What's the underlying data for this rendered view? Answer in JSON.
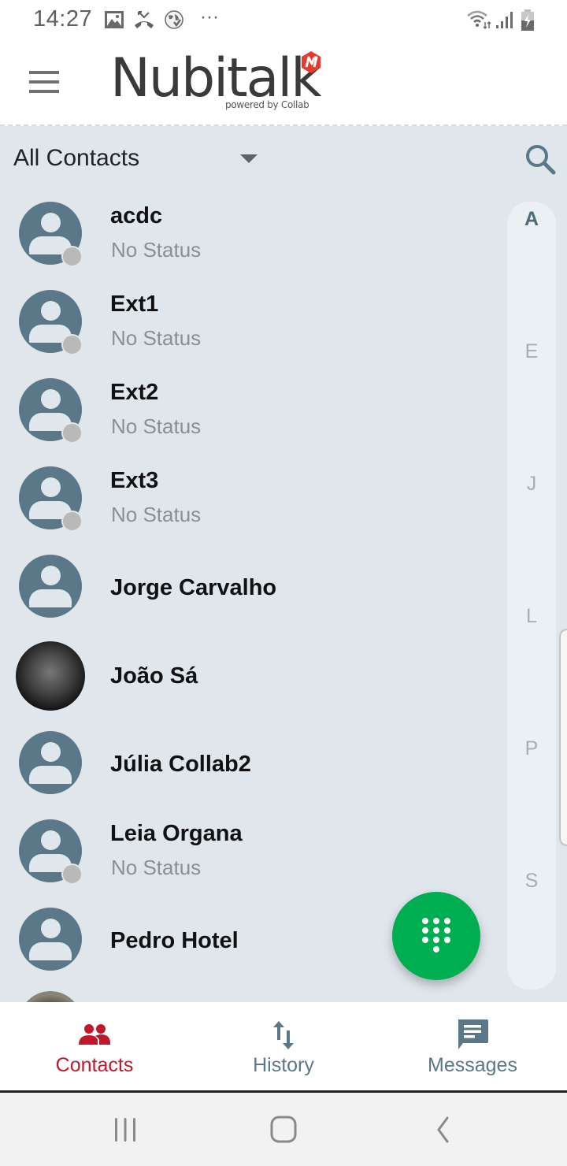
{
  "status_bar": {
    "time": "14:27",
    "left_icons": [
      "gallery-icon",
      "missed-call-icon",
      "vpn-globe-icon",
      "more-dots-icon"
    ],
    "more": "···",
    "right_icons": [
      "wifi-icon",
      "signal-icon",
      "battery-charging-icon"
    ]
  },
  "app_bar": {
    "menu_icon": "hamburger-icon",
    "logo_text": "Nubitalk",
    "logo_subtitle": "powered by Collab",
    "brand_color": "#e8392e"
  },
  "filter": {
    "selected": "All Contacts",
    "search_icon": "search-icon"
  },
  "contacts": [
    {
      "name": "acdc",
      "status": "No Status",
      "avatar": "default",
      "presence": true
    },
    {
      "name": "Ext1",
      "status": "No Status",
      "avatar": "default",
      "presence": true
    },
    {
      "name": "Ext2",
      "status": "No Status",
      "avatar": "default",
      "presence": true
    },
    {
      "name": "Ext3",
      "status": "No Status",
      "avatar": "default",
      "presence": true
    },
    {
      "name": "Jorge Carvalho",
      "status": null,
      "avatar": "default",
      "presence": false
    },
    {
      "name": "João Sá",
      "status": null,
      "avatar": "photo",
      "presence": false
    },
    {
      "name": "Júlia Collab2",
      "status": null,
      "avatar": "default",
      "presence": false
    },
    {
      "name": "Leia Organa",
      "status": "No Status",
      "avatar": "default",
      "presence": true
    },
    {
      "name": "Pedro Hotel",
      "status": null,
      "avatar": "default",
      "presence": false
    }
  ],
  "index_letters": [
    "A",
    "E",
    "J",
    "L",
    "P",
    "S"
  ],
  "index_active": "A",
  "fab": {
    "icon": "dialpad-icon",
    "color": "#00ae52"
  },
  "bottom_nav": {
    "items": [
      {
        "label": "Contacts",
        "icon": "contacts-icon",
        "active": true
      },
      {
        "label": "History",
        "icon": "history-arrows-icon",
        "active": false
      },
      {
        "label": "Messages",
        "icon": "messages-icon",
        "active": false
      }
    ],
    "active_color": "#c0172b",
    "inactive_color": "#5a7888"
  },
  "system_nav": [
    "recents-button",
    "home-button",
    "back-button"
  ]
}
